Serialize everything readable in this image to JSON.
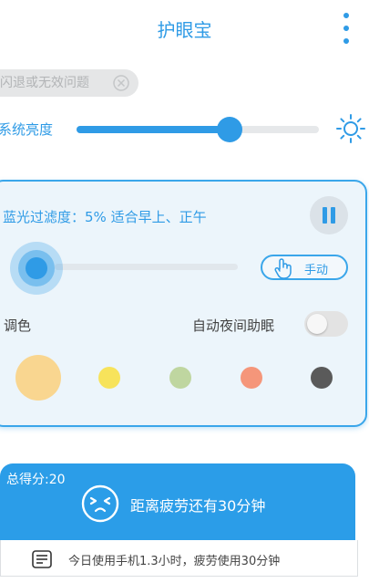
{
  "header": {
    "title": "护眼宝",
    "menu_icon": "more-vert-icon"
  },
  "notice": {
    "text": "闪退或无效问题",
    "close_icon": "close-circle-icon"
  },
  "brightness": {
    "label": "系统亮度",
    "value_fraction": 0.63,
    "icon": "sun-icon",
    "accent": "#2f9be6"
  },
  "filter": {
    "label": "蓝光过滤度：5% 适合早上、正午",
    "value_fraction": 0.0,
    "pause_icon": "pause-icon",
    "manual": {
      "icon": "hand-pointer-icon",
      "label": "手动"
    }
  },
  "tone": {
    "label": "调色",
    "auto_night_label": "自动夜间助眠",
    "auto_night_on": false,
    "swatches": [
      "#f9d690",
      "#f7e35b",
      "#bfd6a0",
      "#f5967a",
      "#5a5a5a"
    ],
    "selected_index": 0
  },
  "banner": {
    "score": "总得分:20",
    "face_icon": "tired-face-icon",
    "fatigue_text": "距离疲劳还有30分钟",
    "usage_icon": "list-icon",
    "usage_text": "今日使用手机1.3小时，疲劳使用30分钟"
  }
}
